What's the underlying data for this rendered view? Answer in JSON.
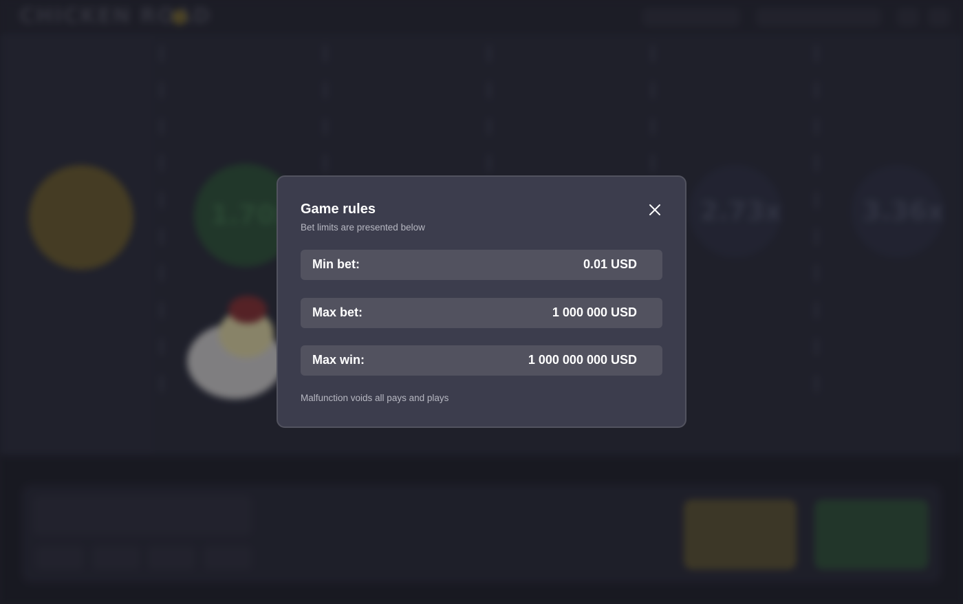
{
  "background": {
    "logo": "CHICKEN ROAD",
    "multipliers": [
      "1.70x",
      "2.73x",
      "3.36x"
    ]
  },
  "modal": {
    "title": "Game rules",
    "subtitle": "Bet limits are presented below",
    "close_icon": "close-icon",
    "rows": [
      {
        "label": "Min bet:",
        "value": "0.01 USD"
      },
      {
        "label": "Max bet:",
        "value": "1 000 000 USD"
      },
      {
        "label": "Max win:",
        "value": "1 000 000 000 USD"
      }
    ],
    "footnote": "Malfunction voids all pays and plays"
  },
  "colors": {
    "modal_bg": "#3c3d4d",
    "row_bg": "#52525f",
    "page_bg": "#22232d",
    "cashout_btn": "#5e5530",
    "go_btn": "#2f5236"
  }
}
